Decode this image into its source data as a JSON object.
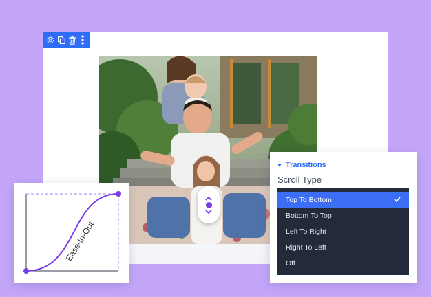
{
  "editor": {
    "toolbar": {
      "icons": [
        "gear-icon",
        "duplicate-icon",
        "trash-icon",
        "more-vertical-icon"
      ]
    },
    "image": {
      "description_icon": "photo"
    }
  },
  "easing": {
    "label": "Ease-In-Out",
    "curve_color": "#7a3ce6"
  },
  "panel": {
    "section_title": "Transitions",
    "field_label": "Scroll Type",
    "options": [
      {
        "label": "Top To Bottom",
        "selected": true
      },
      {
        "label": "Bottom To Top",
        "selected": false
      },
      {
        "label": "Left To Right",
        "selected": false
      },
      {
        "label": "Right To Left",
        "selected": false
      },
      {
        "label": "Off",
        "selected": false
      }
    ]
  },
  "colors": {
    "background": "#c4a6f9",
    "accent": "#2f6df6",
    "purple": "#7a3ce6",
    "dropdown_bg": "#232b3a"
  }
}
